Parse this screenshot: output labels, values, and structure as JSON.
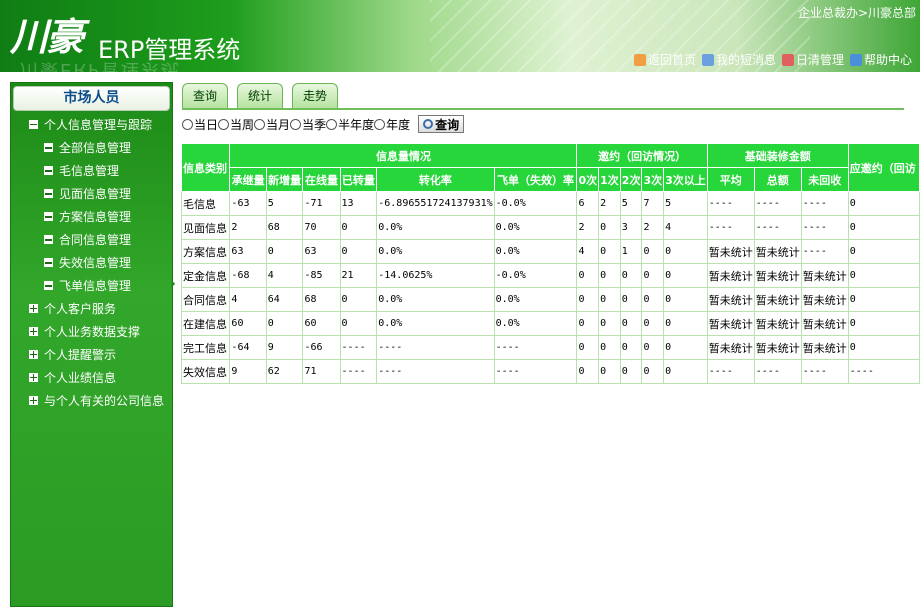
{
  "header": {
    "logo_glyph": "川豪",
    "title": "ERP管理系统",
    "logo_reflect": "川豪ERP管理系统",
    "breadcrumb": "企业总裁办>川豪总部",
    "links": [
      {
        "label": "返回首页",
        "icon": "home-icon",
        "color": "#f0a040"
      },
      {
        "label": "我的短消息",
        "icon": "message-icon",
        "color": "#6aa0e0"
      },
      {
        "label": "日清管理",
        "icon": "calendar-icon",
        "color": "#e06060"
      },
      {
        "label": "帮助中心",
        "icon": "help-icon",
        "color": "#4a8fd8"
      }
    ]
  },
  "sidebar": {
    "title": "市场人员",
    "items": [
      {
        "label": "个人信息管理与跟踪",
        "level": 0,
        "marker": "minus"
      },
      {
        "label": "全部信息管理",
        "level": 1,
        "marker": "dash"
      },
      {
        "label": "毛信息管理",
        "level": 1,
        "marker": "dash"
      },
      {
        "label": "见面信息管理",
        "level": 1,
        "marker": "dash"
      },
      {
        "label": "方案信息管理",
        "level": 1,
        "marker": "dash"
      },
      {
        "label": "合同信息管理",
        "level": 1,
        "marker": "dash"
      },
      {
        "label": "失效信息管理",
        "level": 1,
        "marker": "dash"
      },
      {
        "label": "飞单信息管理",
        "level": 1,
        "marker": "dash"
      },
      {
        "label": "个人客户服务",
        "level": 0,
        "marker": "plus"
      },
      {
        "label": "个人业务数据支撑",
        "level": 0,
        "marker": "plus"
      },
      {
        "label": "个人提醒警示",
        "level": 0,
        "marker": "plus"
      },
      {
        "label": "个人业绩信息",
        "level": 0,
        "marker": "plus"
      },
      {
        "label": "与个人有关的公司信息",
        "level": 0,
        "marker": "plus"
      }
    ]
  },
  "tabs": [
    "查询",
    "统计",
    "走势"
  ],
  "filters": {
    "options": [
      "当日",
      "当周",
      "当月",
      "当季",
      "半年度",
      "年度"
    ],
    "query_button": "查询"
  },
  "table": {
    "group_headers": {
      "category": "信息类别",
      "info": "信息量情况",
      "appointment": "邀约（回访情况）",
      "deposit": "基础装修金额",
      "pending": "应邀约（回访"
    },
    "sub_headers": [
      "承继量",
      "新增量",
      "在线量",
      "已转量",
      "转化率",
      "飞单（失效）率",
      "0次",
      "1次",
      "2次",
      "3次",
      "3次以上",
      "平均",
      "总额",
      "未回收"
    ],
    "rows": [
      {
        "label": "毛信息",
        "cells": [
          "-63",
          "5",
          "-71",
          "13",
          "-6.896551724137931%",
          "-0.0%",
          "6",
          "2",
          "5",
          "7",
          "5",
          "----",
          "----",
          "----",
          "0"
        ]
      },
      {
        "label": "见面信息",
        "cells": [
          "2",
          "68",
          "70",
          "0",
          "0.0%",
          "0.0%",
          "2",
          "0",
          "3",
          "2",
          "4",
          "----",
          "----",
          "----",
          "0"
        ]
      },
      {
        "label": "方案信息",
        "cells": [
          "63",
          "0",
          "63",
          "0",
          "0.0%",
          "0.0%",
          "4",
          "0",
          "1",
          "0",
          "0",
          "暂未统计",
          "暂未统计",
          "----",
          "0"
        ]
      },
      {
        "label": "定金信息",
        "cells": [
          "-68",
          "4",
          "-85",
          "21",
          "-14.0625%",
          "-0.0%",
          "0",
          "0",
          "0",
          "0",
          "0",
          "暂未统计",
          "暂未统计",
          "暂未统计",
          "0"
        ]
      },
      {
        "label": "合同信息",
        "cells": [
          "4",
          "64",
          "68",
          "0",
          "0.0%",
          "0.0%",
          "0",
          "0",
          "0",
          "0",
          "0",
          "暂未统计",
          "暂未统计",
          "暂未统计",
          "0"
        ]
      },
      {
        "label": "在建信息",
        "cells": [
          "60",
          "0",
          "60",
          "0",
          "0.0%",
          "0.0%",
          "0",
          "0",
          "0",
          "0",
          "0",
          "暂未统计",
          "暂未统计",
          "暂未统计",
          "0"
        ]
      },
      {
        "label": "完工信息",
        "cells": [
          "-64",
          "9",
          "-66",
          "----",
          "----",
          "----",
          "0",
          "0",
          "0",
          "0",
          "0",
          "暂未统计",
          "暂未统计",
          "暂未统计",
          "0"
        ]
      },
      {
        "label": "失效信息",
        "cells": [
          "9",
          "62",
          "71",
          "----",
          "----",
          "----",
          "0",
          "0",
          "0",
          "0",
          "0",
          "----",
          "----",
          "----",
          "----"
        ]
      }
    ]
  }
}
